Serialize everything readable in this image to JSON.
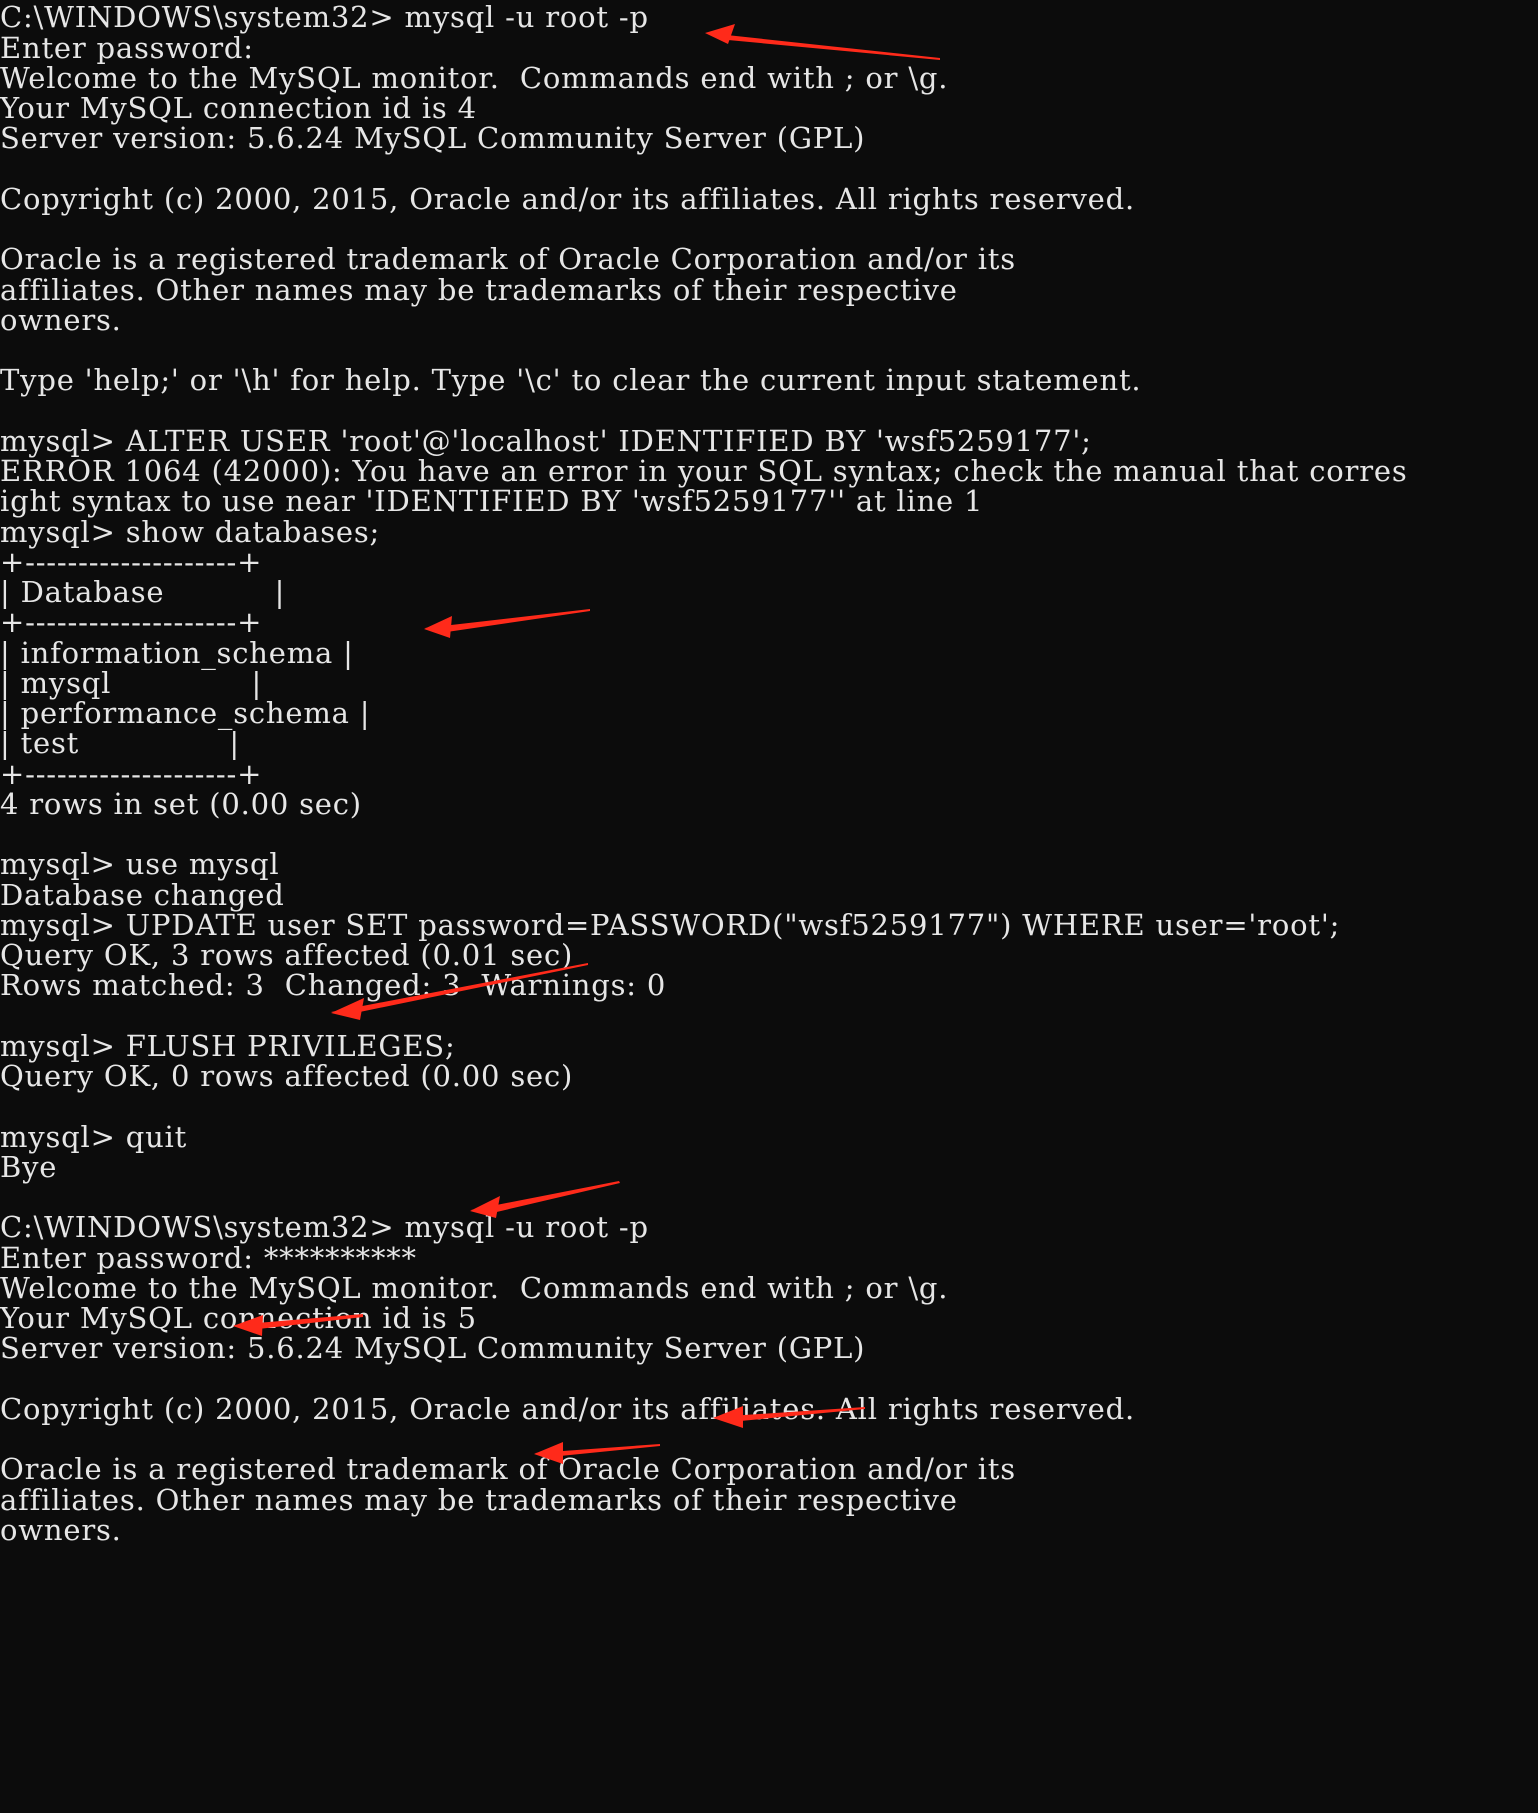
{
  "terminal": {
    "lines": [
      "C:\\WINDOWS\\system32> mysql -u root -p",
      "Enter password:",
      "Welcome to the MySQL monitor.  Commands end with ; or \\g.",
      "Your MySQL connection id is 4",
      "Server version: 5.6.24 MySQL Community Server (GPL)",
      "",
      "Copyright (c) 2000, 2015, Oracle and/or its affiliates. All rights reserved.",
      "",
      "Oracle is a registered trademark of Oracle Corporation and/or its",
      "affiliates. Other names may be trademarks of their respective",
      "owners.",
      "",
      "Type 'help;' or '\\h' for help. Type '\\c' to clear the current input statement.",
      "",
      "mysql> ALTER USER 'root'@'localhost' IDENTIFIED BY 'wsf5259177';",
      "ERROR 1064 (42000): You have an error in your SQL syntax; check the manual that corres",
      "ight syntax to use near 'IDENTIFIED BY 'wsf5259177'' at line 1",
      "mysql> show databases;",
      "+--------------------+",
      "| Database           |",
      "+--------------------+",
      "| information_schema |",
      "| mysql              |",
      "| performance_schema |",
      "| test               |",
      "+--------------------+",
      "4 rows in set (0.00 sec)",
      "",
      "mysql> use mysql",
      "Database changed",
      "mysql> UPDATE user SET password=PASSWORD(\"wsf5259177\") WHERE user='root';",
      "Query OK, 3 rows affected (0.01 sec)",
      "Rows matched: 3  Changed: 3  Warnings: 0",
      "",
      "mysql> FLUSH PRIVILEGES;",
      "Query OK, 0 rows affected (0.00 sec)",
      "",
      "mysql> quit",
      "Bye",
      "",
      "C:\\WINDOWS\\system32> mysql -u root -p",
      "Enter password: **********",
      "Welcome to the MySQL monitor.  Commands end with ; or \\g.",
      "Your MySQL connection id is 5",
      "Server version: 5.6.24 MySQL Community Server (GPL)",
      "",
      "Copyright (c) 2000, 2015, Oracle and/or its affiliates. All rights reserved.",
      "",
      "Oracle is a registered trademark of Oracle Corporation and/or its",
      "affiliates. Other names may be trademarks of their respective",
      "owners."
    ]
  },
  "colors": {
    "background": "#0c0c0c",
    "text": "#e6e6e6",
    "arrow": "#ff2a1a"
  },
  "annotations": {
    "icon": "red-arrow-icon"
  }
}
